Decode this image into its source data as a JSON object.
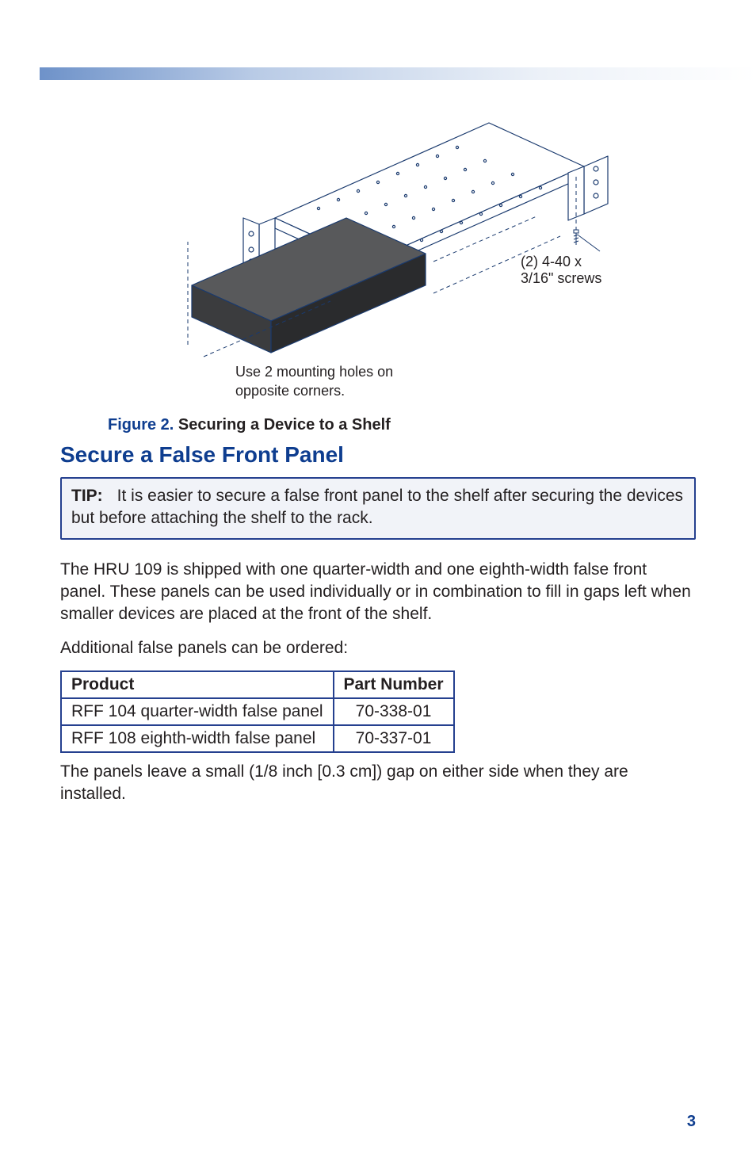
{
  "figure": {
    "label_screws": "(2) 4-40 x 3/16\" screws",
    "label_holes_line1": "Use 2 mounting holes on",
    "label_holes_line2": "opposite corners.",
    "caption_num": "Figure 2.",
    "caption_title": "Securing a Device to a Shelf"
  },
  "section": {
    "heading": "Secure a False Front Panel"
  },
  "tip": {
    "label": "TIP:",
    "text": "It is easier to secure a false front panel to the shelf after securing the devices but before attaching the shelf to the rack."
  },
  "paragraphs": {
    "p1": "The HRU 109 is shipped with one quarter-width and one eighth-width false front panel. These panels can be used individually or in combination to fill in gaps left when smaller devices are placed at the front of the shelf.",
    "p2": "Additional false panels can be ordered:",
    "p3": "The panels leave a small (1/8 inch [0.3 cm]) gap on either side when they are installed."
  },
  "table": {
    "headers": {
      "product": "Product",
      "part_number": "Part Number"
    },
    "rows": [
      {
        "product": "RFF 104 quarter-width false panel",
        "part_number": "70-338-01"
      },
      {
        "product": "RFF 108 eighth-width false panel",
        "part_number": "70-337-01"
      }
    ]
  },
  "page_number": "3"
}
